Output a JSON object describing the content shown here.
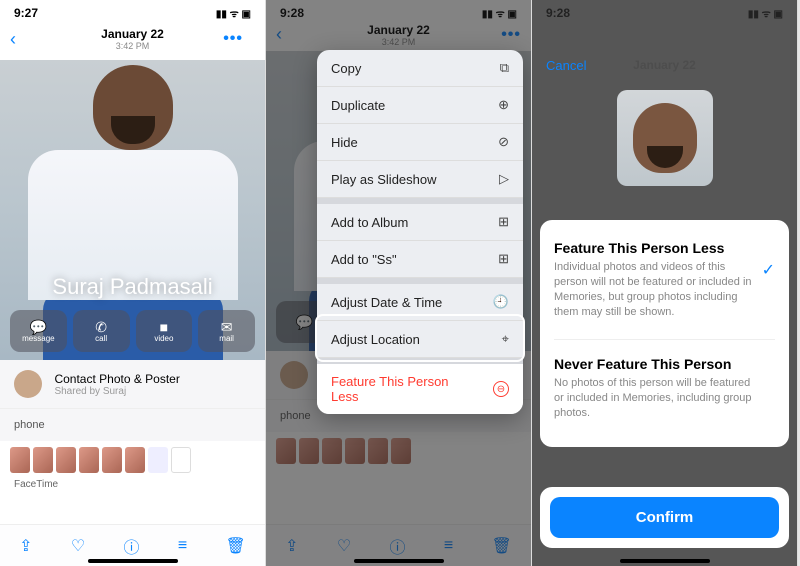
{
  "status": {
    "t1": "9:27",
    "t2": "9:28",
    "t3": "9:28",
    "icons": "▮▮ ᯤ ▣"
  },
  "nav": {
    "date": "January 22",
    "sub": "3:42 PM",
    "more": "•••"
  },
  "hero": {
    "name": "Suraj Padmasali",
    "actions": [
      "message",
      "call",
      "video",
      "mail"
    ]
  },
  "contact": {
    "title": "Contact Photo & Poster",
    "sub": "Shared by Suraj"
  },
  "phone_label": "phone",
  "facetime_label": "FaceTime",
  "toolbar": {
    "share": "⇪",
    "fav": "♡",
    "info": "ⓘ",
    "adjust": "≡",
    "trash": "🗑"
  },
  "menu": {
    "items": [
      {
        "label": "Copy",
        "icon": "⧉"
      },
      {
        "label": "Duplicate",
        "icon": "⊕"
      },
      {
        "label": "Hide",
        "icon": "⊘"
      },
      {
        "label": "Play as Slideshow",
        "icon": "▷"
      },
      {
        "label": "Add to Album",
        "icon": "⊞"
      },
      {
        "label": "Add to \"Ss\"",
        "icon": "⊞"
      },
      {
        "label": "Adjust Date & Time",
        "icon": "🕘"
      },
      {
        "label": "Adjust Location",
        "icon": "⌖"
      }
    ],
    "danger": {
      "label": "Feature This Person Less",
      "icon": "⊖"
    }
  },
  "sheet": {
    "cancel": "Cancel",
    "opt1_title": "Feature This Person Less",
    "opt1_desc": "Individual photos and videos of this person will not be featured or included in Memories, but group photos including them may still be shown.",
    "opt2_title": "Never Feature This Person",
    "opt2_desc": "No photos of this person will be featured or included in Memories, including group photos.",
    "subtext": "",
    "confirm": "Confirm"
  }
}
